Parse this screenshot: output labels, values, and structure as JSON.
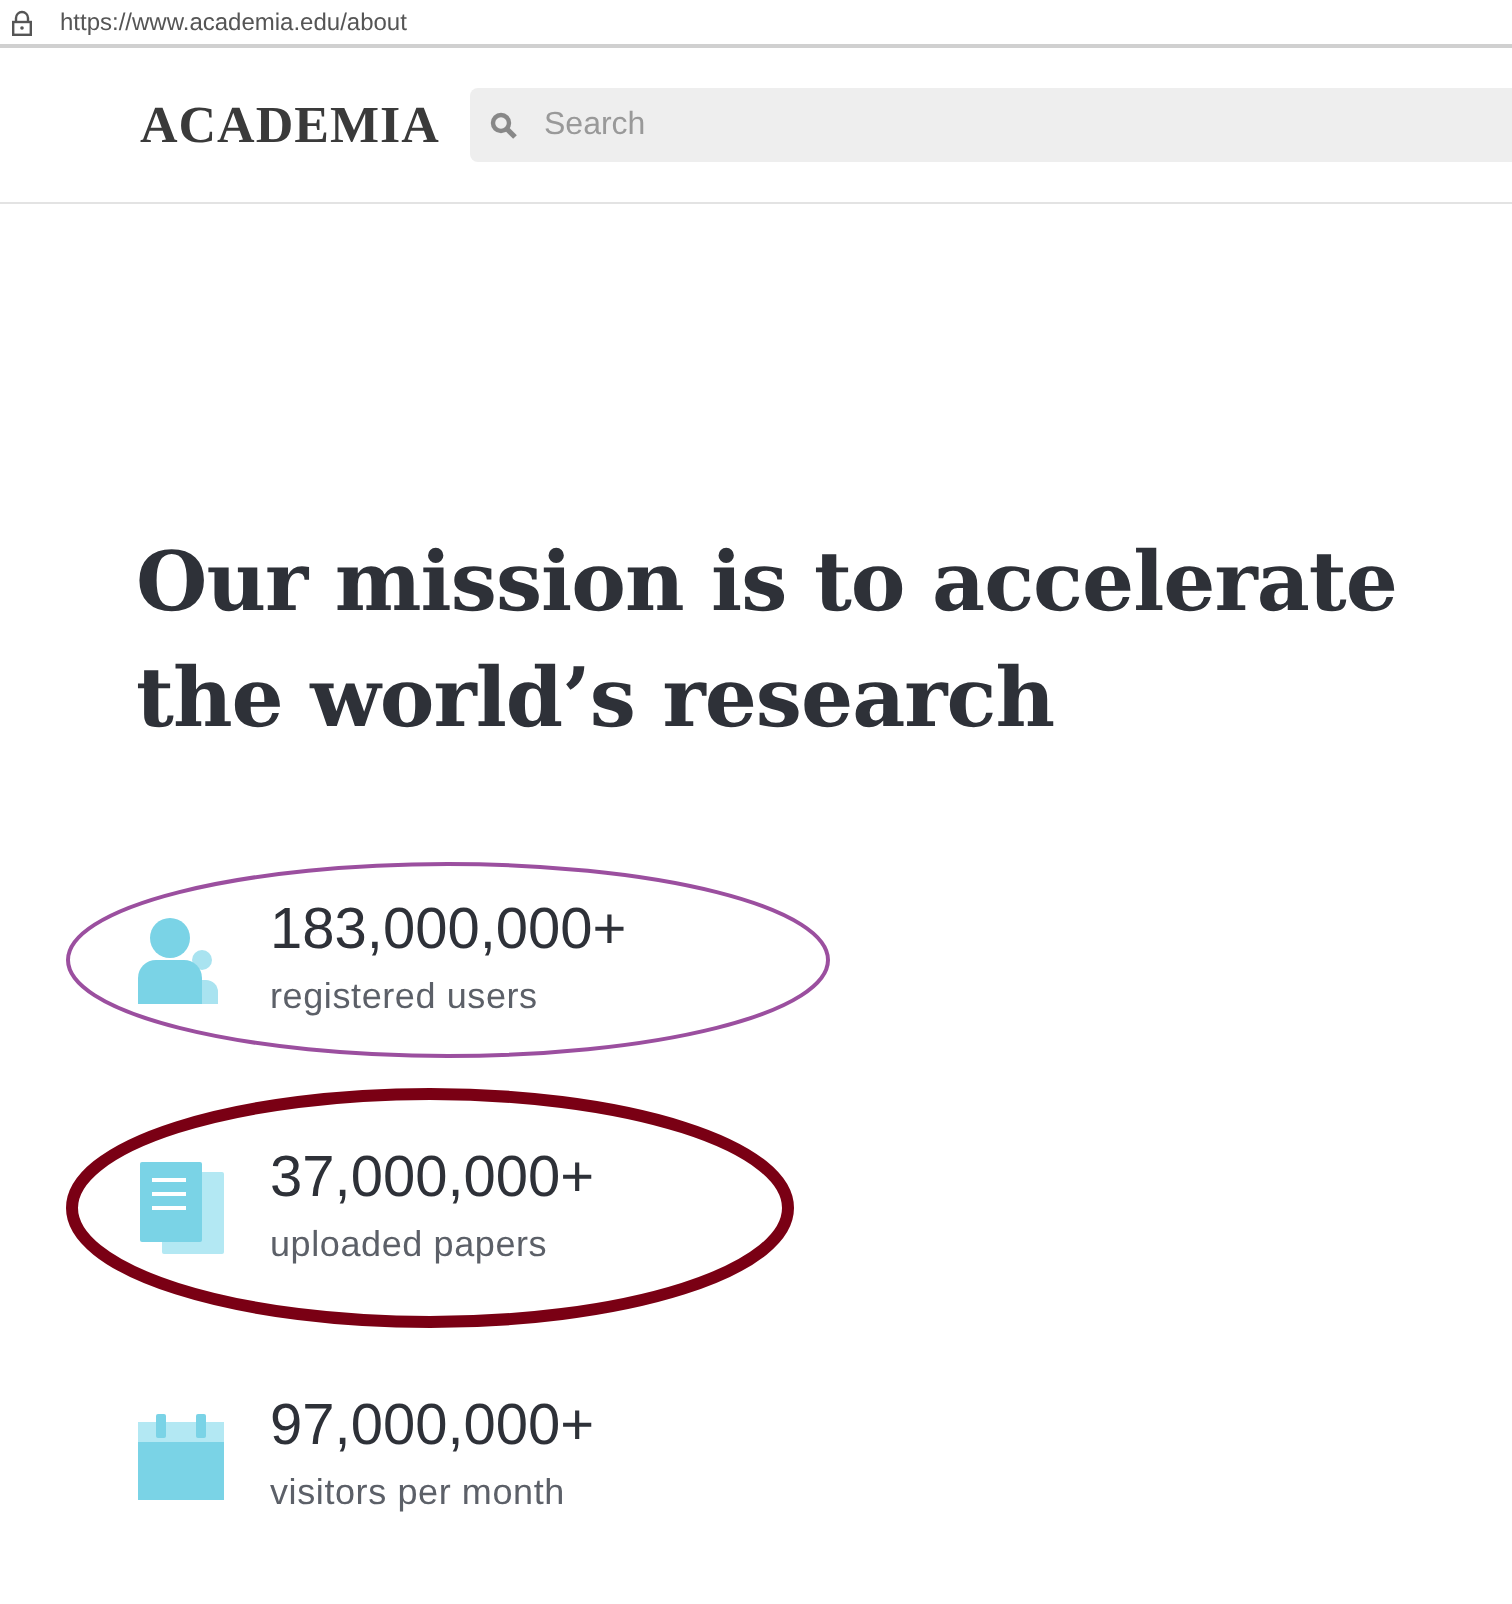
{
  "address_bar": {
    "url": "https://www.academia.edu/about"
  },
  "header": {
    "logo": "ACADEMIA",
    "search": {
      "placeholder": "Search"
    }
  },
  "headline": "Our mission is to accelerate the world’s research",
  "stats": [
    {
      "kind": "users",
      "value": "183,000,000+",
      "label": "registered users",
      "circle": {
        "color": "#9b4f9f"
      }
    },
    {
      "kind": "papers",
      "value": "37,000,000+",
      "label": "uploaded papers",
      "circle": {
        "color": "#7a0014"
      }
    },
    {
      "kind": "visitors",
      "value": "97,000,000+",
      "label": "visitors per month"
    }
  ]
}
